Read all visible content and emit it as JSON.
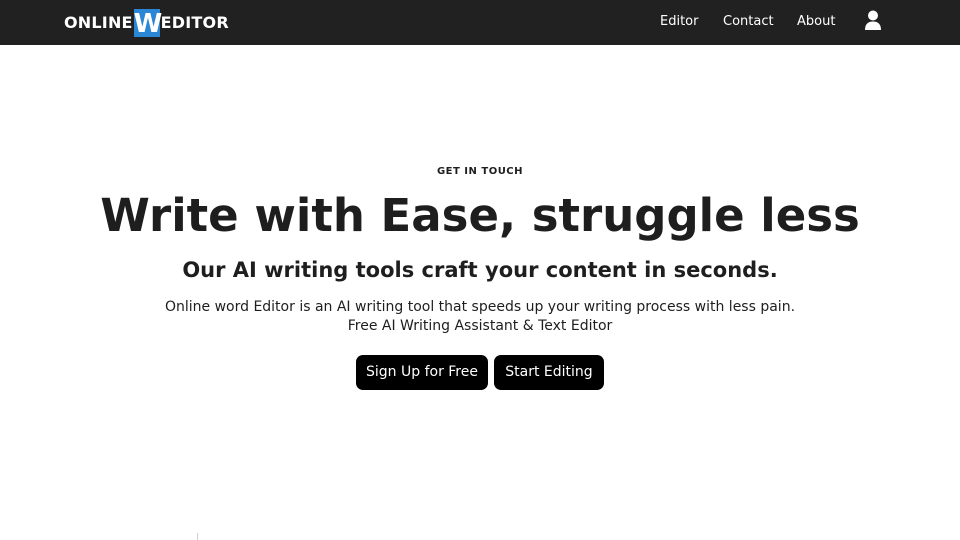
{
  "header": {
    "logo": {
      "prefix": "ONLINE",
      "mark": "W",
      "suffix": "EDITOR",
      "mark_color": "#2b86d6"
    },
    "nav": [
      {
        "label": "Editor"
      },
      {
        "label": "Contact"
      },
      {
        "label": "About"
      }
    ],
    "account_icon": "user-icon",
    "background_color": "#212121"
  },
  "hero": {
    "kicker": "GET IN TOUCH",
    "title": "Write with Ease, struggle less",
    "subtitle": "Our AI writing tools craft your content in seconds.",
    "description_line1": "Online word Editor is an AI writing tool that speeds up your writing process with less pain.",
    "description_line2": "Free AI Writing Assistant & Text Editor",
    "buttons": {
      "signup_label": "Sign Up for Free",
      "start_label": "Start Editing"
    }
  }
}
